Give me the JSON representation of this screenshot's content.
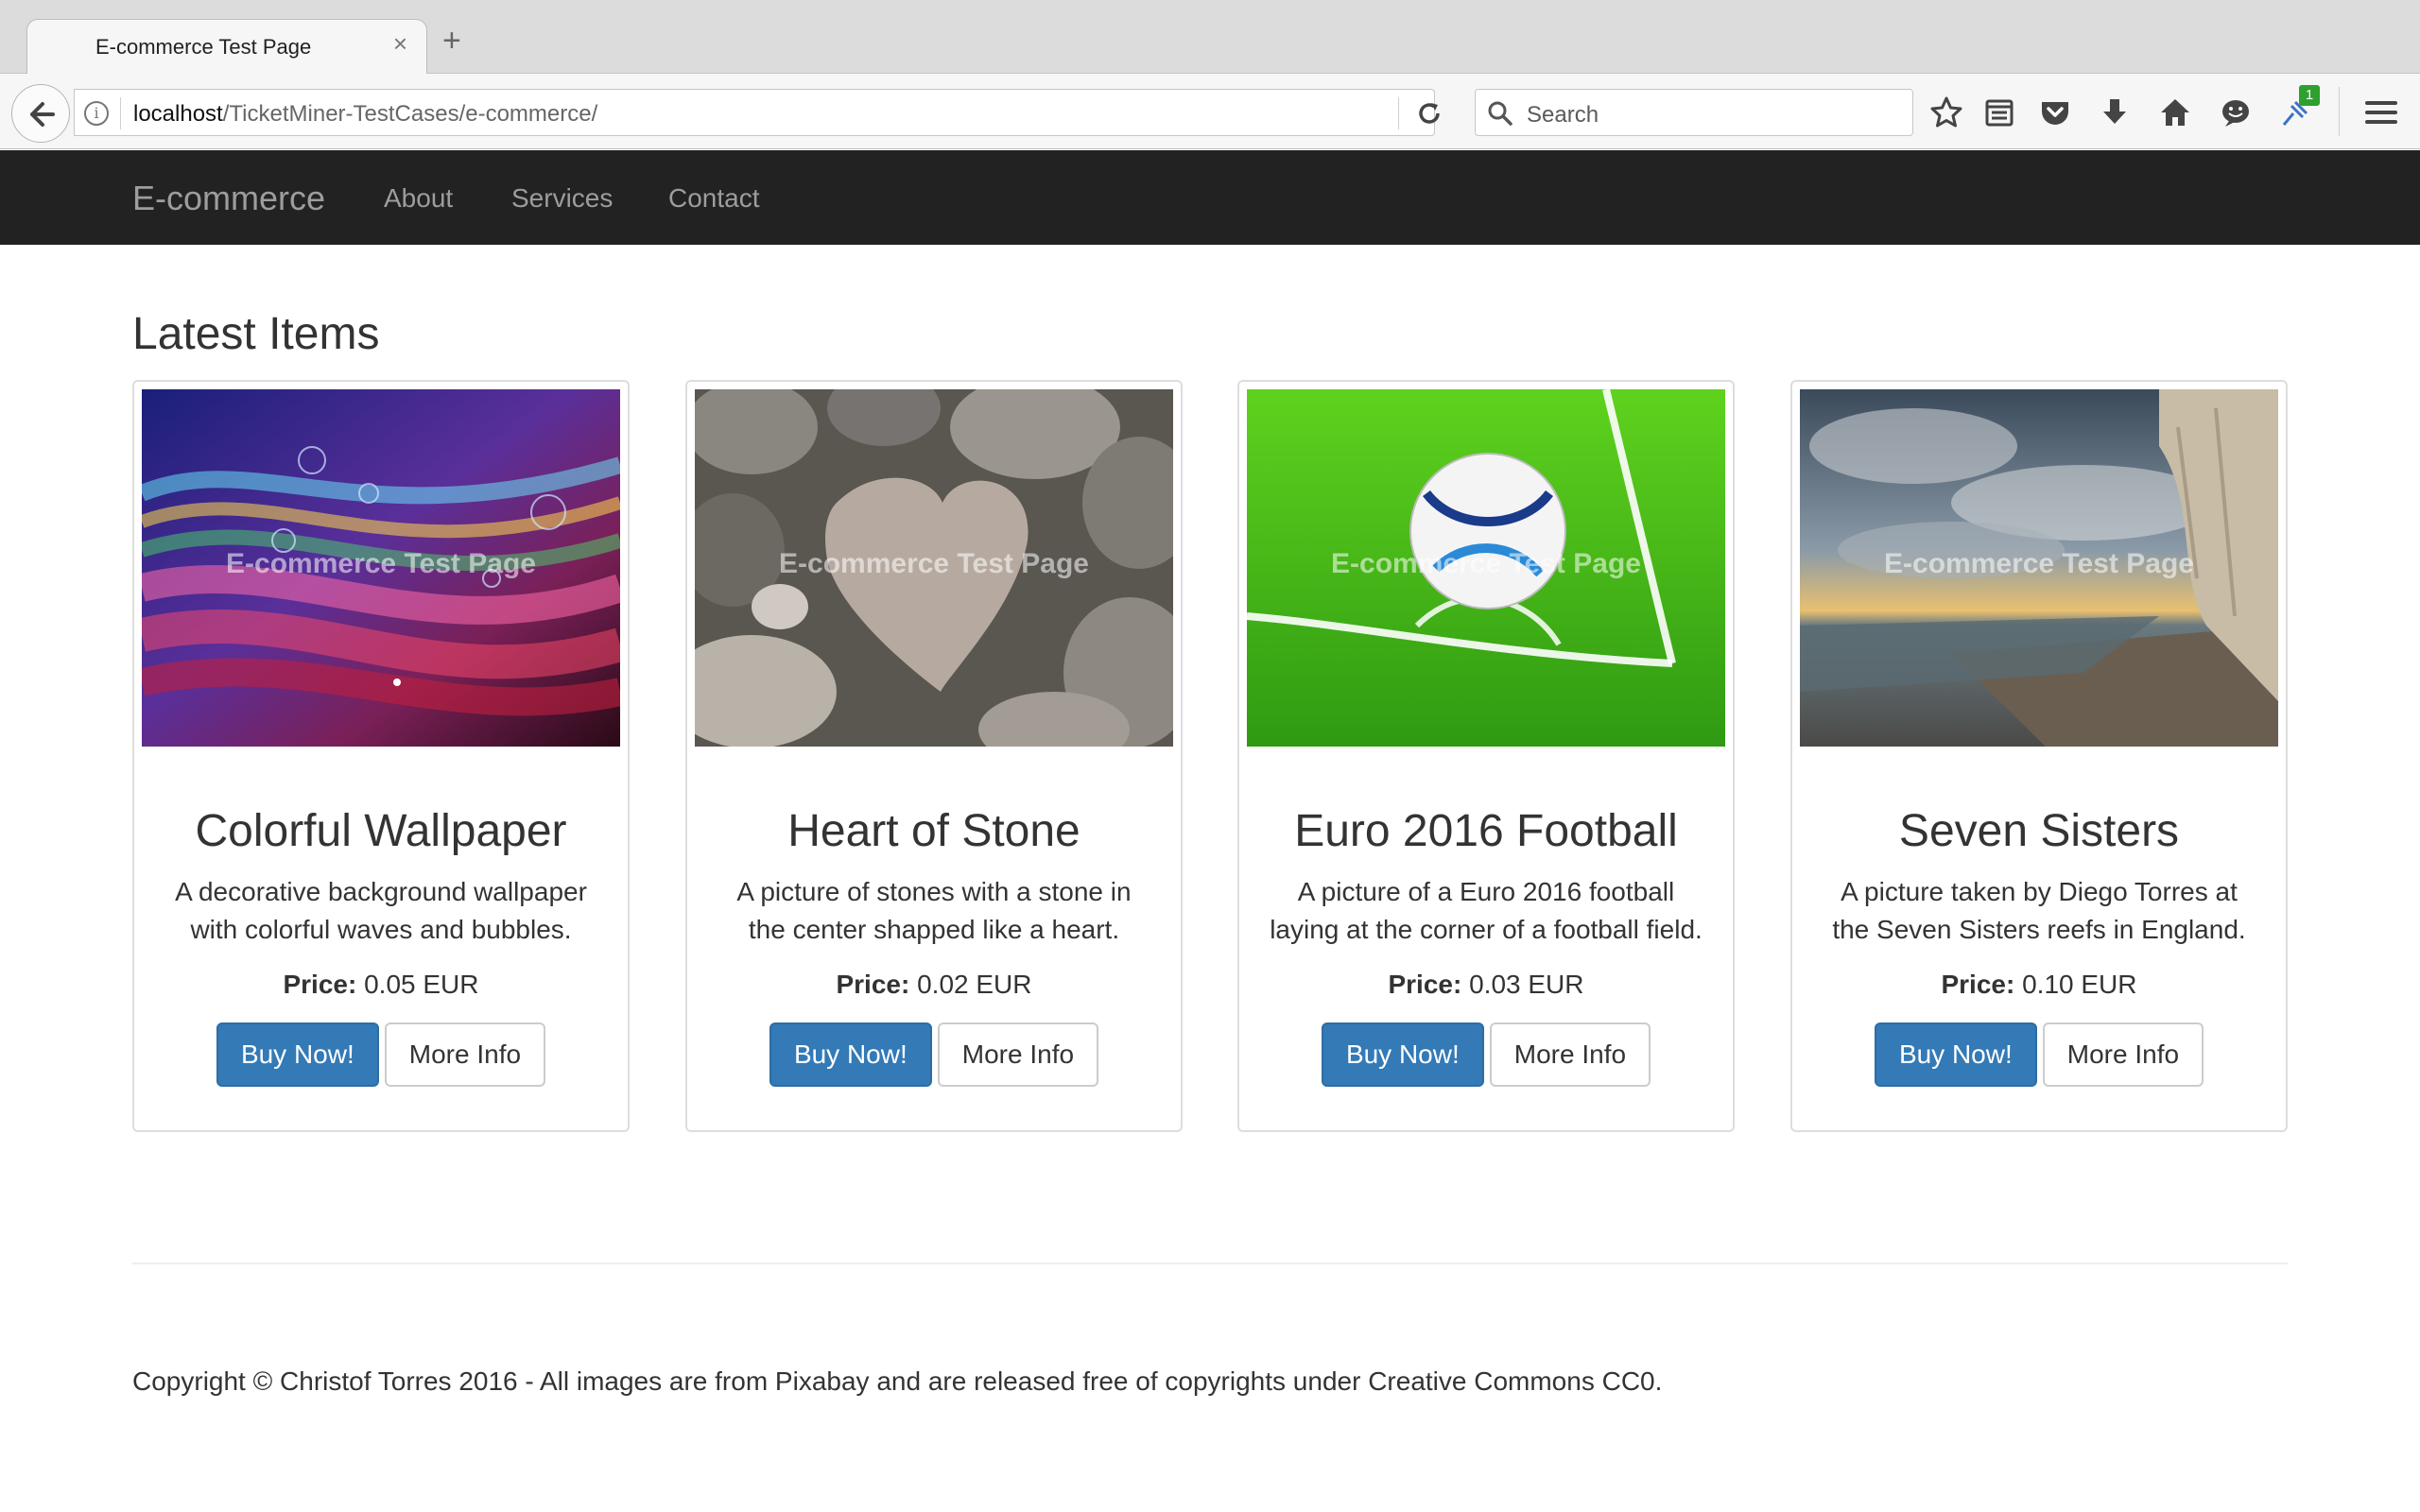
{
  "browser": {
    "tab_title": "E-commerce Test Page",
    "url_host": "localhost",
    "url_path": "/TicketMiner-TestCases/e-commerce/",
    "search_placeholder": "Search",
    "notification_count": "1"
  },
  "navbar": {
    "brand": "E-commerce",
    "links": [
      "About",
      "Services",
      "Contact"
    ]
  },
  "main": {
    "heading": "Latest Items",
    "watermark": "E-commerce Test Page",
    "price_label": "Price:",
    "buy_label": "Buy Now!",
    "info_label": "More Info",
    "items": [
      {
        "title": "Colorful Wallpaper",
        "description": "A decorative background wallpaper with colorful waves and bubbles.",
        "price": "0.05 EUR",
        "image": "colorful-waves"
      },
      {
        "title": "Heart of Stone",
        "description": "A picture of stones with a stone in the center shapped like a heart.",
        "price": "0.02 EUR",
        "image": "heart-stone"
      },
      {
        "title": "Euro 2016 Football",
        "description": "A picture of a Euro 2016 football laying at the corner of a football field.",
        "price": "0.03 EUR",
        "image": "football-field"
      },
      {
        "title": "Seven Sisters",
        "description": "A picture taken by Diego Torres at the Seven Sisters reefs in England.",
        "price": "0.10 EUR",
        "image": "seven-sisters-cliffs"
      }
    ]
  },
  "footer": {
    "copyright": "Copyright © Christof Torres 2016 - All images are from Pixabay and are released free of copyrights under Creative Commons CC0."
  },
  "colors": {
    "navbar_bg": "#222222",
    "primary": "#337ab7"
  }
}
